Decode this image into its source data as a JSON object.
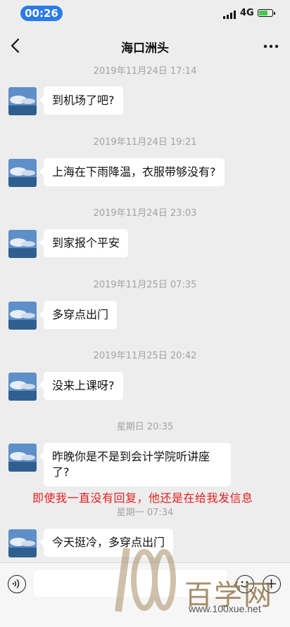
{
  "status_bar": {
    "time": "00:26",
    "network": "4G"
  },
  "chat": {
    "title": "海口洲头"
  },
  "messages": [
    {
      "timestamp": "2019年11月24日 17:14",
      "text": "到机场了吧?"
    },
    {
      "timestamp": "2019年11月24日 19:21",
      "text": "上海在下雨降温，衣服带够没有?"
    },
    {
      "timestamp": "2019年11月24日 23:03",
      "text": "到家报个平安"
    },
    {
      "timestamp": "2019年11月25日 07:35",
      "text": "多穿点出门"
    },
    {
      "timestamp": "2019年11月25日 20:42",
      "text": "没来上课呀?"
    },
    {
      "timestamp": "星期日 20:35",
      "text": "昨晚你是不是到会计学院听讲座\n了?"
    },
    {
      "timestamp": "星期一 07:34",
      "text": "今天挺冷，多穿点出门"
    }
  ],
  "annotation": "即使我一直没有回复，他还是在给我发信息",
  "watermark": {
    "text": "百学网",
    "url": "www.100xue.net"
  },
  "colors": {
    "background": "#ededed",
    "bubble": "#ffffff",
    "annotation": "#e61e1e",
    "time_pill": "#2b7be9"
  }
}
